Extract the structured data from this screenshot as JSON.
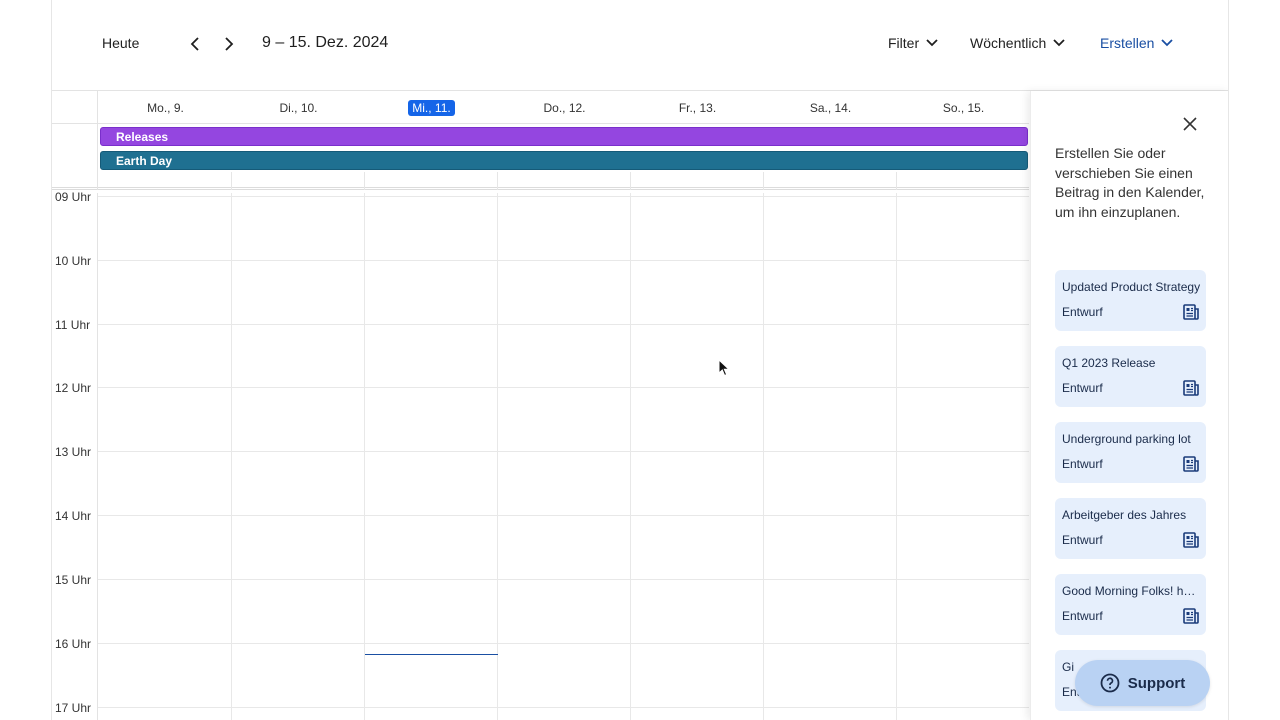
{
  "header": {
    "today_label": "Heute",
    "date_range": "9 – 15. Dez. 2024",
    "filter_label": "Filter",
    "view_label": "Wöchentlich",
    "create_label": "Erstellen"
  },
  "days": [
    {
      "label": "Mo., 9.",
      "today": false
    },
    {
      "label": "Di., 10.",
      "today": false
    },
    {
      "label": "Mi., 11.",
      "today": true
    },
    {
      "label": "Do., 12.",
      "today": false
    },
    {
      "label": "Fr., 13.",
      "today": false
    },
    {
      "label": "Sa., 14.",
      "today": false
    },
    {
      "label": "So., 15.",
      "today": false
    }
  ],
  "allday_events": [
    {
      "label": "Releases",
      "color": "#9446e0"
    },
    {
      "label": "Earth Day",
      "color": "#1f7091"
    }
  ],
  "hours": [
    "09 Uhr",
    "10 Uhr",
    "11 Uhr",
    "12 Uhr",
    "13 Uhr",
    "14 Uhr",
    "15 Uhr",
    "16 Uhr",
    "17 Uhr"
  ],
  "panel": {
    "instructions": "Erstellen Sie oder verschieben Sie einen Beitrag in den Kalender, um ihn einzuplanen.",
    "cards": [
      {
        "title": "Updated Product Strategy",
        "status": "Entwurf"
      },
      {
        "title": "Q1 2023 Release",
        "status": "Entwurf"
      },
      {
        "title": "Underground parking lot",
        "status": "Entwurf"
      },
      {
        "title": "Arbeitgeber des Jahres",
        "status": "Entwurf"
      },
      {
        "title": "Good Morning Folks! how are you",
        "status": "Entwurf"
      },
      {
        "title": "Gi",
        "status": "Entwurf"
      }
    ]
  },
  "support": {
    "label": "Support"
  },
  "colors": {
    "accent": "#1565e8",
    "link": "#1a4fa3",
    "card_bg": "#e6effc"
  }
}
